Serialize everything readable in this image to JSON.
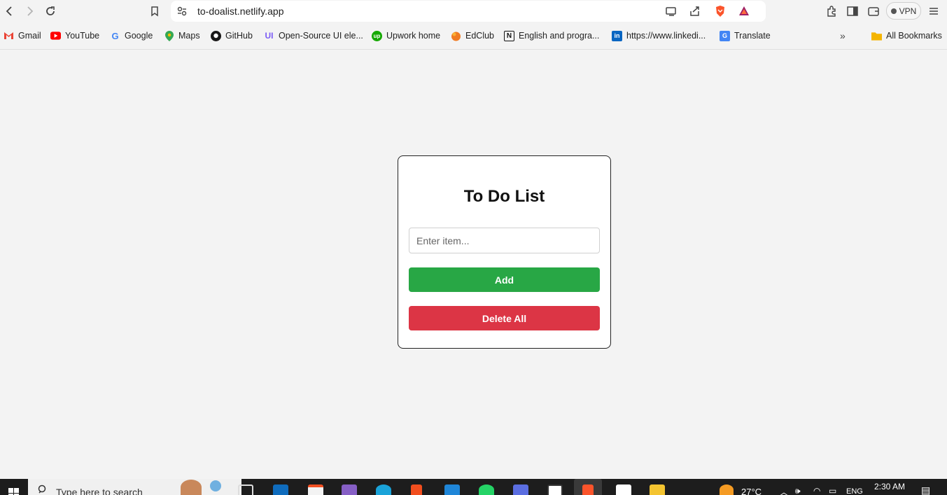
{
  "browser": {
    "url": "to-doalist.netlify.app",
    "vpn_label": "VPN"
  },
  "bookmarks": [
    {
      "label": "Gmail",
      "icon": "gmail-icon",
      "color": "#ea4335"
    },
    {
      "label": "YouTube",
      "icon": "youtube-icon",
      "color": "#ff0000"
    },
    {
      "label": "Google",
      "icon": "google-icon",
      "color": "#4285f4"
    },
    {
      "label": "Maps",
      "icon": "maps-icon",
      "color": "#34a853"
    },
    {
      "label": "GitHub",
      "icon": "github-icon",
      "color": "#181717"
    },
    {
      "label": "Open-Source UI ele...",
      "icon": "uiverse-icon",
      "color": "#7b5cf5"
    },
    {
      "label": "Upwork home",
      "icon": "upwork-icon",
      "color": "#14a800"
    },
    {
      "label": "EdClub",
      "icon": "edclub-icon",
      "color": "#f07b22"
    },
    {
      "label": "English and progra...",
      "icon": "notion-icon",
      "color": "#111111"
    },
    {
      "label": "https://www.linkedi...",
      "icon": "linkedin-icon",
      "color": "#0a66c2"
    },
    {
      "label": "Translate",
      "icon": "translate-icon",
      "color": "#4285f4"
    }
  ],
  "all_bookmarks_label": "All Bookmarks",
  "todo": {
    "title": "To Do List",
    "input_placeholder": "Enter item...",
    "add_label": "Add",
    "delete_all_label": "Delete All",
    "add_color": "#28a745",
    "delete_color": "#dc3545"
  },
  "taskbar": {
    "search_placeholder": "Type here to search",
    "temperature": "27°C",
    "language": "ENG",
    "time": "2:30 AM"
  }
}
